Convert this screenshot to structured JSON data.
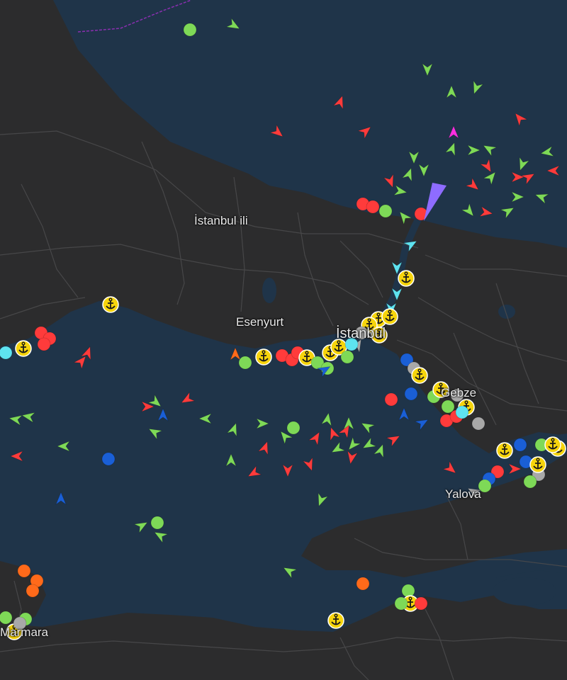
{
  "map": {
    "colors": {
      "water": "#1f3449",
      "land": "#2c2c2d",
      "road": "#4a4a4c",
      "label": "#e8e8e8"
    },
    "place_labels": [
      {
        "id": "istanbul-ili",
        "text": "İstanbul ili"
      },
      {
        "id": "esenyurt",
        "text": "Esenyurt"
      },
      {
        "id": "istanbul",
        "text": "İstanbul"
      },
      {
        "id": "gebze",
        "text": "Gebze"
      },
      {
        "id": "yalova",
        "text": "Yalova"
      },
      {
        "id": "marmara",
        "text": "Marmara"
      }
    ],
    "vessel_legend": {
      "cargo": "#7ed957",
      "tanker": "#ff3b3b",
      "passenger": "#1a5fd6",
      "tug_special": "#5ee3f0",
      "high_speed": "#ff6a1a",
      "pleasure": "#ff2ee0",
      "unknown": "#a8a8a8",
      "anchored": "#f6d40c"
    }
  }
}
